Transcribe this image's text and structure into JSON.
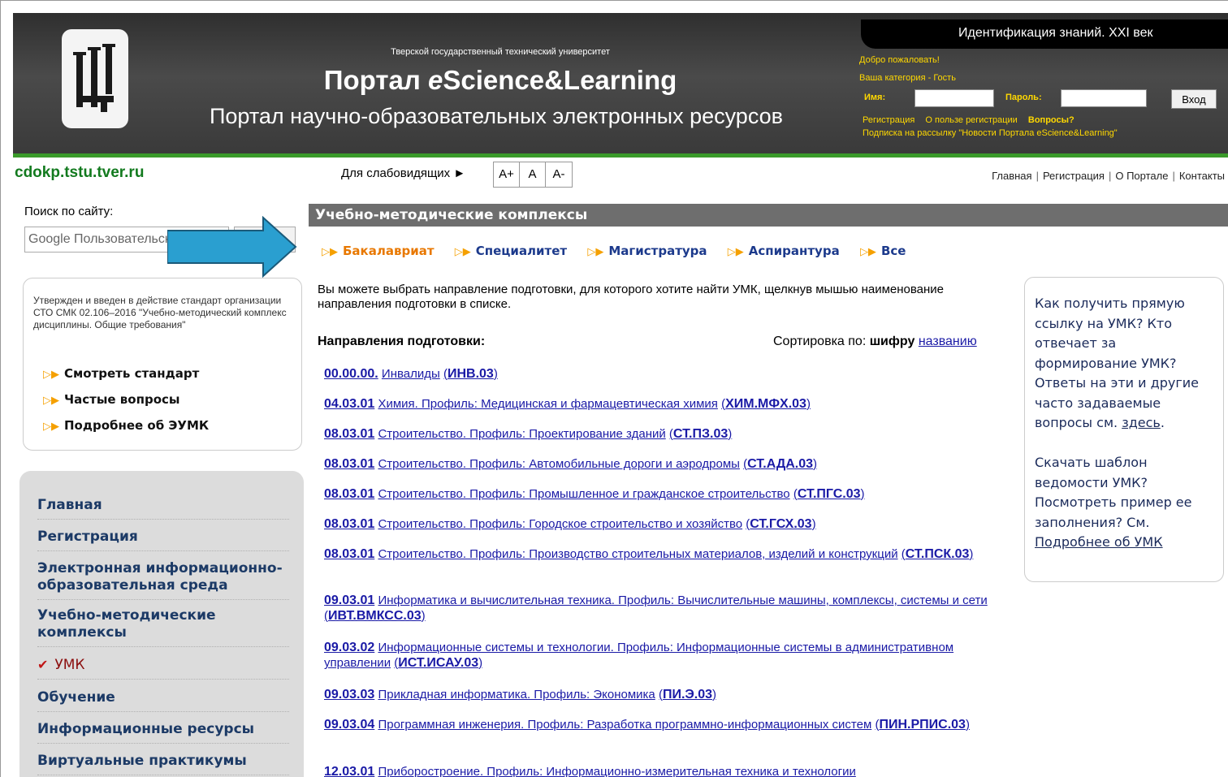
{
  "header": {
    "university": "Тверской государственный технический университет",
    "portal_title": "Портал eScience&Learning",
    "portal_title_prefix": "Портал ",
    "portal_title_e": "e",
    "portal_title_rest": "Science&Learning",
    "portal_subtitle": "Портал научно-образовательных электронных ресурсов",
    "ident_bar": "Идентификация знаний. XXI век",
    "welcome": "Добро пожаловать!",
    "category_label": "Ваша категория - ",
    "category_value": "Гость",
    "name_label": "Имя:",
    "password_label": "Пароль:",
    "login_button": "Вход",
    "register_link": "Регистрация",
    "benefit_link": "О пользе регистрации",
    "questions_link": "Вопросы?",
    "subscribe_link": "Подписка на рассылку \"Новости Портала eScience&Learning\""
  },
  "topbar": {
    "site_name": "cdokp.tstu.tver.ru",
    "low_vision": "Для слабовидящих ►",
    "font_buttons": [
      "A+",
      "A",
      "A-"
    ],
    "nav": [
      "Главная",
      "Регистрация",
      "О Портале",
      "Контакты"
    ]
  },
  "sidebar": {
    "search_label": "Поиск по сайту:",
    "search_placeholder": "Google Пользовательский поиск",
    "standard_text": "Утвержден и введен в действие стандарт организации СТО СМК 02.106–2016 \"Учебно-методический комплекс дисциплины. Общие требования\"",
    "standard_links": [
      "Смотреть стандарт",
      "Частые вопросы",
      "Подробнее об ЭУМК"
    ],
    "menu": [
      "Главная",
      "Регистрация",
      "Электронная информационно-образовательная среда",
      "Учебно-методические комплексы",
      "УМК",
      "Обучение",
      "Информационные ресурсы",
      "Виртуальные практикумы"
    ]
  },
  "main": {
    "section_title": "Учебно-методические комплексы",
    "tabs": [
      "Бакалавриат",
      "Специалитет",
      "Магистратура",
      "Аспирантура",
      "Все"
    ],
    "selected_tab": "Бакалавриат",
    "intro": "Вы можете выбрать направление подготовки, для которого хотите найти УМК, щелкнув мышью наименование направления подготовки в списке.",
    "directions_header": "Направления подготовки:",
    "sort_label": "Сортировка по:",
    "sort_code": "шифру",
    "sort_name": "названию",
    "programs": [
      {
        "code": "00.00.00.",
        "name": "Инвалиды",
        "abbr": "ИНВ.03"
      },
      {
        "code": "04.03.01",
        "name": "Химия. Профиль: Медицинская и фармацевтическая химия",
        "abbr": "ХИМ.МФХ.03"
      },
      {
        "code": "08.03.01",
        "name": "Строительство. Профиль: Проектирование зданий",
        "abbr": "СТ.ПЗ.03"
      },
      {
        "code": "08.03.01",
        "name": "Строительство. Профиль: Автомобильные дороги и аэродромы",
        "abbr": "СТ.АДА.03"
      },
      {
        "code": "08.03.01",
        "name": "Строительство. Профиль: Промышленное и гражданское строительство",
        "abbr": "СТ.ПГС.03"
      },
      {
        "code": "08.03.01",
        "name": "Строительство. Профиль: Городское строительство и хозяйство",
        "abbr": "СТ.ГСХ.03"
      },
      {
        "code": "08.03.01",
        "name": "Строительство. Профиль: Производство строительных материалов, изделий и конструкций",
        "abbr": "СТ.ПСК.03"
      },
      {
        "code": "09.03.01",
        "name": "Информатика и вычислительная техника. Профиль: Вычислительные машины, комплексы, системы и сети",
        "abbr": "ИВТ.ВМКСС.03"
      },
      {
        "code": "09.03.02",
        "name": "Информационные системы и технологии. Профиль: Информационные системы в административном управлении",
        "abbr": "ИСТ.ИСАУ.03"
      },
      {
        "code": "09.03.03",
        "name": "Прикладная информатика. Профиль: Экономика",
        "abbr": "ПИ.Э.03"
      },
      {
        "code": "09.03.04",
        "name": "Программная инженерия. Профиль: Разработка программно-информационных систем",
        "abbr": "ПИН.РПИС.03"
      },
      {
        "code": "12.03.01",
        "name": "Приборостроение. Профиль: Информационно-измерительная техника и технологии",
        "abbr": ""
      }
    ]
  },
  "faq": {
    "text1": "Как получить прямую ссылку на УМК? Кто отвечает за формирование УМК? Ответы на эти и другие часто задаваемые вопросы см. ",
    "link1": "здесь",
    "text2": "Скачать шаблон ведомости УМК? Посмотреть пример ее заполнения? См. ",
    "link2": "Подробнее об УМК"
  },
  "colors": {
    "header_bg": "#3a3a3a",
    "green_accent": "#3a9a2a",
    "site_name": "#127a1e",
    "tab_selected": "#e87800",
    "tab": "#1c3a8c",
    "arrow": "#2a9fd0",
    "link": "#1a1aa6"
  }
}
